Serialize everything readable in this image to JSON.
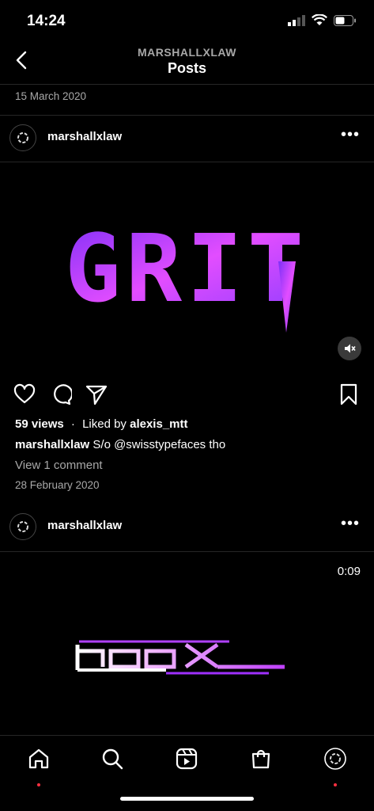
{
  "status": {
    "time": "14:24"
  },
  "header": {
    "username": "MARSHALLXLAW",
    "title": "Posts"
  },
  "prev_post": {
    "date": "15 March 2020"
  },
  "post1": {
    "username": "marshallxlaw",
    "more": "•••",
    "media_text": "GRIT",
    "views": "59 views",
    "liked_prefix": "Liked by",
    "liked_user": "alexis_mtt",
    "caption_user": "marshallxlaw",
    "caption_text": "S/o @swisstypefaces tho",
    "comments_link": "View 1 comment",
    "date": "28 February 2020"
  },
  "post2": {
    "username": "marshallxlaw",
    "more": "•••",
    "duration": "0:09"
  },
  "colors": {
    "accent": "#ff3040",
    "muted": "#a8a8a8",
    "divider": "#262626"
  }
}
